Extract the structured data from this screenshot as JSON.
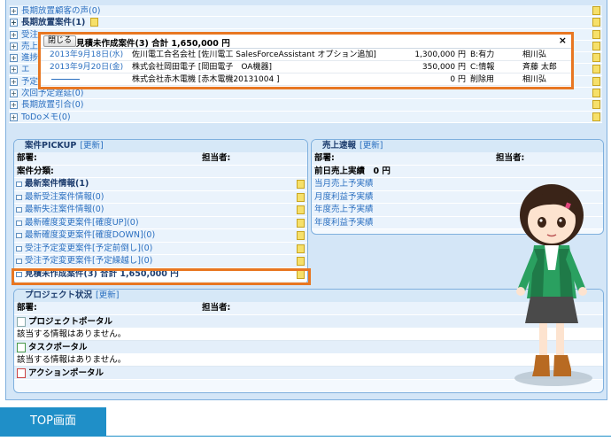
{
  "top_list": [
    {
      "label": "長期放置顧客の声(0)",
      "style": "link"
    },
    {
      "label": "長期放置案件(1)",
      "style": "bold"
    },
    {
      "label": "受注",
      "style": "link"
    },
    {
      "label": "売上",
      "style": "link"
    },
    {
      "label": "進捗",
      "style": "link"
    },
    {
      "label": "エ",
      "style": "link"
    },
    {
      "label": "予定見込",
      "style": "link"
    },
    {
      "label": "次回予定遅延(0)",
      "style": "link"
    },
    {
      "label": "長期放置引合(0)",
      "style": "link"
    },
    {
      "label": "ToDoメモ(0)",
      "style": "link"
    }
  ],
  "popup": {
    "close_label": "閉じる",
    "title": "見積未作成案件(3) 合計 1,650,000 円",
    "close_x": "×",
    "rows": [
      {
        "date": "2013年9月18日(水)",
        "customer": "佐川電工合名会社 [佐川電工 SalesForceAssistant オプション追加]",
        "amount": "1,300,000 円",
        "prob": "B:有力",
        "owner": "相川弘"
      },
      {
        "date": "2013年9月20日(金)",
        "customer": "株式会社岡田電子 [岡田電子　OA機器]",
        "amount": "350,000 円",
        "prob": "C:情報",
        "owner": "斉藤 太郎"
      },
      {
        "date": "",
        "customer": "株式会社赤木電機 [赤木電機20131004 ]",
        "amount": "0 円",
        "prob": "削除用",
        "owner": "相川弘"
      }
    ]
  },
  "pickup": {
    "title": "案件PICKUP",
    "update": "[更新]",
    "dept_label": "部署:",
    "owner_label": "担当者:",
    "category_label": "案件分類:",
    "items": [
      {
        "label": "最新案件情報(1)",
        "bold": true
      },
      {
        "label": "最新受注案件情報(0)",
        "bold": false
      },
      {
        "label": "最新失注案件情報(0)",
        "bold": false
      },
      {
        "label": "最新確度変更案件[確度UP](0)",
        "bold": false
      },
      {
        "label": "最新確度変更案件[確度DOWN](0)",
        "bold": false
      },
      {
        "label": "受注予定変更案件[予定前倒し](0)",
        "bold": false
      },
      {
        "label": "受注予定変更案件[予定繰越し](0)",
        "bold": false
      },
      {
        "label": "見積未作成案件(3) 合計 1,650,000 円",
        "bold": true
      }
    ]
  },
  "sales": {
    "title": "売上速報",
    "update": "[更新]",
    "dept_label": "部署:",
    "owner_label": "担当者:",
    "items": [
      {
        "label": "前日売上実績　0 円",
        "bold": true
      },
      {
        "label": "当月売上予実績",
        "bold": false
      },
      {
        "label": "月度利益予実績",
        "bold": false
      },
      {
        "label": "年度売上予実績",
        "bold": false
      },
      {
        "label": "年度利益予実績",
        "bold": false
      }
    ]
  },
  "project": {
    "title": "プロジェクト状況",
    "update": "[更新]",
    "dept_label": "部署:",
    "owner_label": "担当者:",
    "sections": [
      {
        "label": "プロジェクトポータル",
        "empty": "該当する情報はありません。"
      },
      {
        "label": "タスクポータル",
        "empty": "該当する情報はありません。"
      },
      {
        "label": "アクションポータル",
        "empty": ""
      }
    ]
  },
  "tab_label": "TOP画面",
  "colors": {
    "accent": "#e87722",
    "frame": "#d4e6f7",
    "link": "#2a6fc0",
    "tab": "#1f8fc8"
  }
}
